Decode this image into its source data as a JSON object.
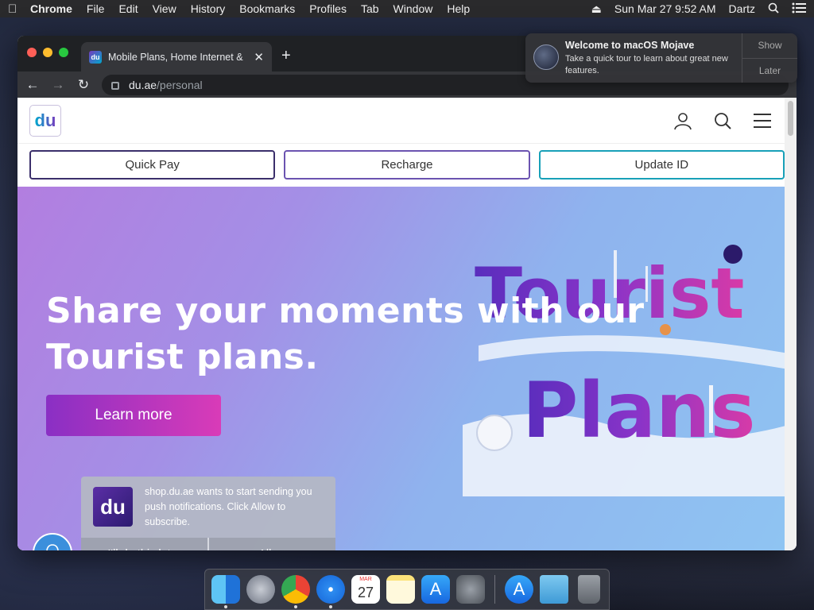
{
  "menubar": {
    "app_name": "Chrome",
    "items": [
      "File",
      "Edit",
      "View",
      "History",
      "Bookmarks",
      "Profiles",
      "Tab",
      "Window",
      "Help"
    ],
    "clock": "Sun Mar 27  9:52 AM",
    "user": "Dartz"
  },
  "browser": {
    "tab_title": "Mobile Plans, Home Internet &",
    "url_host": "du.ae",
    "url_path": "/personal"
  },
  "site": {
    "logo_text": "du",
    "quick_actions": [
      "Quick Pay",
      "Recharge",
      "Update ID"
    ],
    "hero": {
      "title": "Share your moments with our Tourist plans.",
      "button": "Learn more",
      "art_words": [
        "Tourist",
        "Plans"
      ]
    }
  },
  "push_prompt": {
    "logo_text": "du",
    "message": "shop.du.ae wants to start sending you push notifications. Click Allow to subscribe.",
    "later_button": "I'll do this later",
    "allow_button": "Allow"
  },
  "mac_notification": {
    "title": "Welcome to macOS Mojave",
    "body": "Take a quick tour to learn about great new features.",
    "show_button": "Show",
    "later_button": "Later"
  },
  "dock": {
    "calendar_month": "MAR",
    "calendar_day": "27",
    "apps": [
      "finder-icon",
      "launchpad-icon",
      "chrome-icon",
      "safari-icon",
      "calendar-icon",
      "notes-icon",
      "app-store-icon",
      "system-preferences-icon",
      "app-store-icon",
      "downloads-folder-icon",
      "trash-icon"
    ]
  }
}
